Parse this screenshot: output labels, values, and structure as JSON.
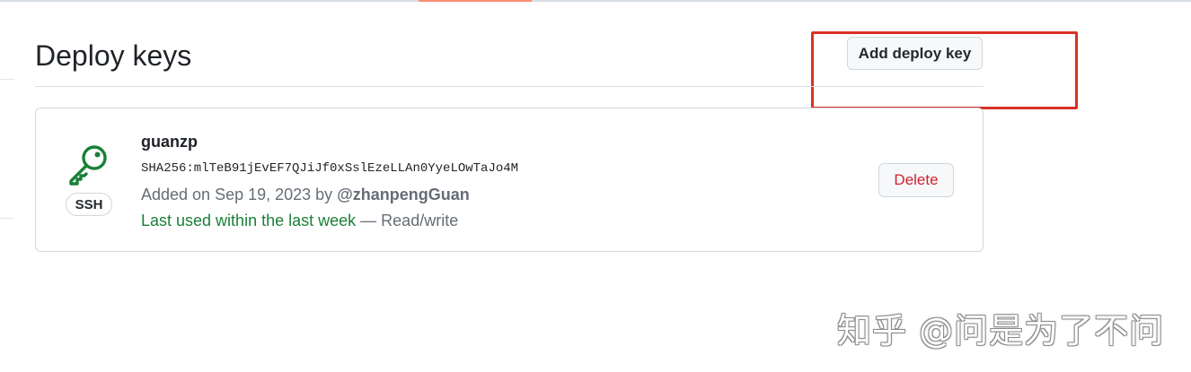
{
  "page": {
    "title": "Deploy keys",
    "add_button_label": "Add deploy key"
  },
  "deploy_key": {
    "icon": "key-icon",
    "type_badge": "SSH",
    "title": "guanzp",
    "fingerprint": "SHA256:mlTeB91jEvEF7QJiJf0xSslEzeLLAn0YyeLOwTaJo4M",
    "added_prefix": "Added on Sep 19, 2023 by",
    "added_by": "@zhanpengGuan",
    "last_used": "Last used within the last week",
    "access_separator": "—",
    "access": "Read/write",
    "delete_label": "Delete"
  },
  "watermark": {
    "text": "知乎 @问是为了不问"
  },
  "colors": {
    "accent_tab": "#fd8c73",
    "highlight_box": "#d93025",
    "key_icon": "#1a7f37",
    "last_used_text": "#1a7f37",
    "delete_text": "#cf222e",
    "muted_text": "#656d76"
  }
}
